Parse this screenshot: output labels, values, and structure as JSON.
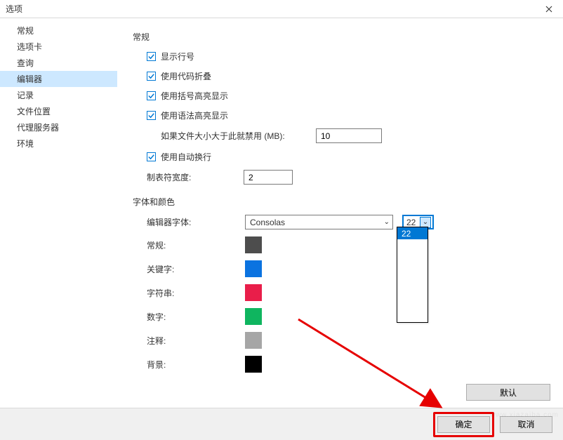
{
  "title": "选项",
  "sidebar": {
    "items": [
      {
        "label": "常规"
      },
      {
        "label": "选项卡"
      },
      {
        "label": "查询"
      },
      {
        "label": "编辑器"
      },
      {
        "label": "记录"
      },
      {
        "label": "文件位置"
      },
      {
        "label": "代理服务器"
      },
      {
        "label": "环境"
      }
    ],
    "selectedIndex": 3
  },
  "sections": {
    "general": {
      "title": "常规",
      "showLineNumbers": {
        "label": "显示行号",
        "checked": true
      },
      "codeFolding": {
        "label": "使用代码折叠",
        "checked": true
      },
      "bracketHighlight": {
        "label": "使用括号高亮显示",
        "checked": true
      },
      "syntaxHighlight": {
        "label": "使用语法高亮显示",
        "checked": true
      },
      "disableIfLarger": {
        "label": "如果文件大小大于此就禁用 (MB):",
        "value": "10"
      },
      "wordWrap": {
        "label": "使用自动换行",
        "checked": true
      },
      "tabWidth": {
        "label": "制表符宽度:",
        "value": "2"
      }
    },
    "fontColor": {
      "title": "字体和颜色",
      "editorFont": {
        "label": "编辑器字体:",
        "value": "Consolas"
      },
      "fontSize": {
        "value": "22",
        "options": [
          "22"
        ]
      },
      "colors": {
        "normal": {
          "label": "常规:",
          "color": "#4d4d4d"
        },
        "keyword": {
          "label": "关键字:",
          "color": "#0b73e0"
        },
        "string": {
          "label": "字符串:",
          "color": "#e91e4a"
        },
        "number": {
          "label": "数字:",
          "color": "#0fb55f"
        },
        "comment": {
          "label": "注释:",
          "color": "#a6a6a6"
        },
        "background": {
          "label": "背景:",
          "color": "#000000"
        }
      }
    }
  },
  "buttons": {
    "default": "默认",
    "ok": "确定",
    "cancel": "取消"
  }
}
